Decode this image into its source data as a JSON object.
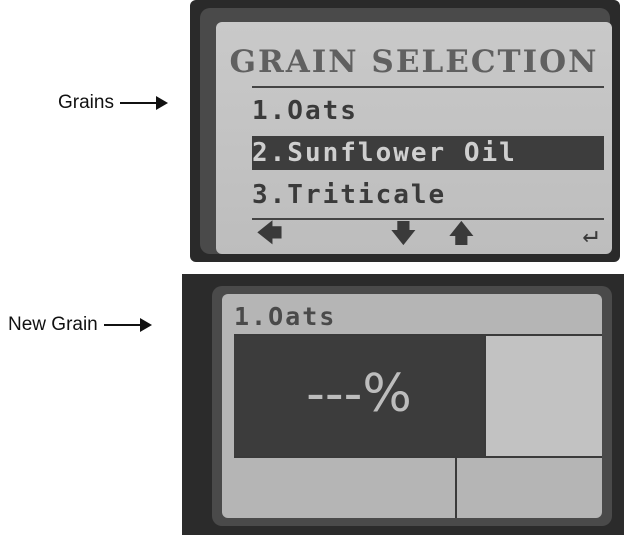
{
  "callouts": {
    "grains": "Grains",
    "new_grain": "New Grain"
  },
  "screen1": {
    "title": "GRAIN SELECTION",
    "items": [
      {
        "label": "1.Oats",
        "selected": false
      },
      {
        "label": "2.Sunflower Oil",
        "selected": true
      },
      {
        "label": "3.Triticale",
        "selected": false
      }
    ],
    "nav": {
      "back": "🡄",
      "down": "🡇",
      "up": "🡅",
      "enter": "↵"
    }
  },
  "screen2": {
    "header": "1.Oats",
    "moisture": "---%"
  }
}
